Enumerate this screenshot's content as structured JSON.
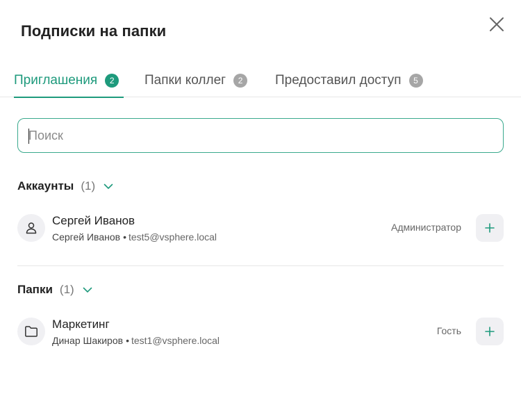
{
  "dialog": {
    "title": "Подписки на папки"
  },
  "tabs": [
    {
      "label": "Приглашения",
      "count": "2",
      "active": true
    },
    {
      "label": "Папки коллег",
      "count": "2",
      "active": false
    },
    {
      "label": "Предоставил доступ",
      "count": "5",
      "active": false
    }
  ],
  "search": {
    "placeholder": "Поиск",
    "value": ""
  },
  "accounts": {
    "title": "Аккаунты",
    "count": "(1)",
    "items": [
      {
        "name": "Сергей Иванов",
        "owner": "Сергей Иванов",
        "email": "test5@vsphere.local",
        "role": "Администратор",
        "icon": "user-icon"
      }
    ]
  },
  "folders": {
    "title": "Папки",
    "count": "(1)",
    "items": [
      {
        "name": "Маркетинг",
        "owner": "Динар Шакиров",
        "email": "test1@vsphere.local",
        "role": "Гость",
        "icon": "folder-icon"
      }
    ]
  },
  "colors": {
    "accent": "#1e9a7c",
    "badge_inactive": "#a6a6a6",
    "icon_bg": "#f0f0f3"
  },
  "icons": {
    "separator": "•"
  }
}
